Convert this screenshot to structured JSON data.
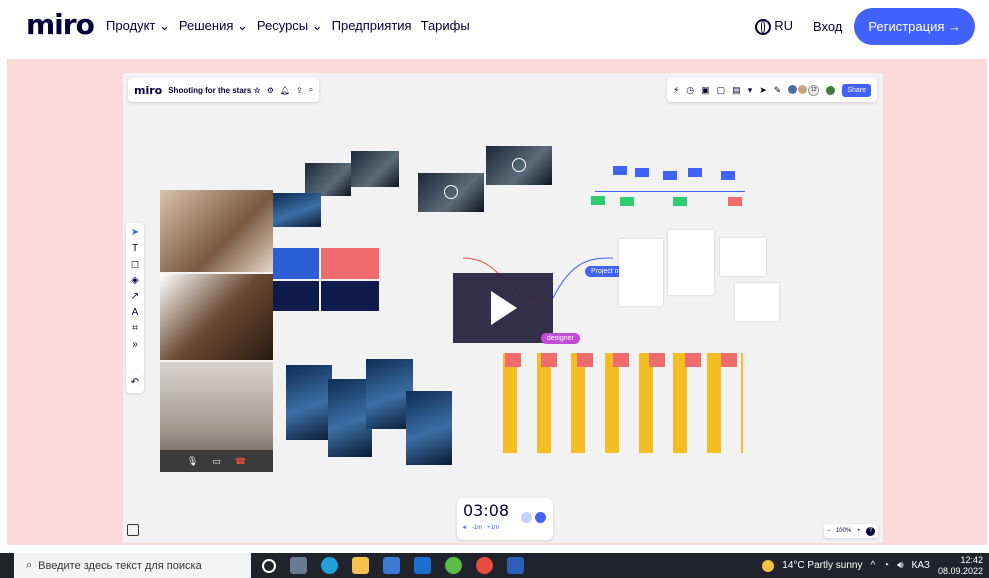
{
  "site_nav": {
    "logo": "miro",
    "menu": [
      "Продукт ⌄",
      "Решения ⌄",
      "Ресурсы ⌄",
      "Предприятия",
      "Тарифы"
    ],
    "language": "RU",
    "login": "Вход",
    "register": "Регистрация →"
  },
  "board": {
    "logo": "miro",
    "title": "Shooting for the stars ☆",
    "share": "Share",
    "avatar_count": "12",
    "tags": {
      "project_manager": "Project manager",
      "designer": "designer"
    },
    "timer": {
      "time": "03:08",
      "minus": "-1m",
      "plus": "+1m"
    },
    "zoom": {
      "minus": "−",
      "level": "100%",
      "plus": "+",
      "help": "?"
    }
  },
  "taskbar": {
    "search_placeholder": "Введите здесь текст для поиска",
    "weather": "14°C  Partly sunny",
    "lang": "КАЗ",
    "time": "12:42",
    "date": "08.09.2022"
  },
  "colors": {
    "accent": "#4262ff",
    "brand_dark": "#050038",
    "canvas_bg": "#fcd9d9"
  }
}
